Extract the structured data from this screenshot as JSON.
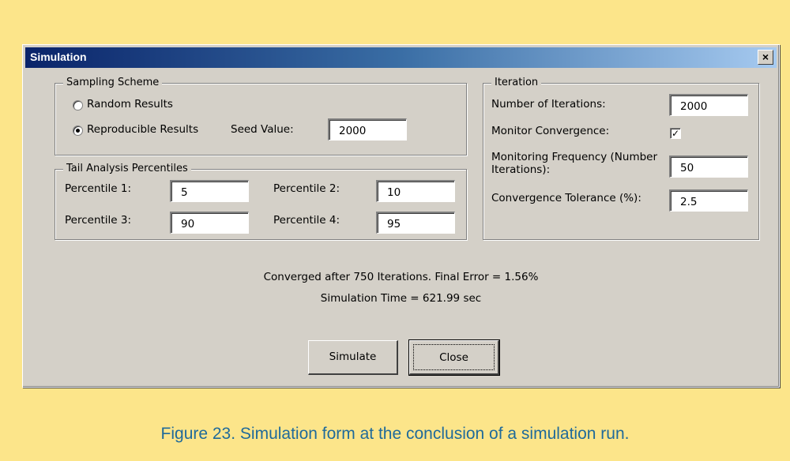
{
  "window": {
    "title": "Simulation",
    "close_glyph": "×"
  },
  "sampling": {
    "group_label": "Sampling Scheme",
    "random_label": "Random Results",
    "reproducible_label": "Reproducible Results",
    "selected": "Reproducible Results",
    "seed_label": "Seed Value:",
    "seed_value": "2000"
  },
  "tail": {
    "group_label": "Tail Analysis Percentiles",
    "p1_label": "Percentile 1:",
    "p1_value": "5",
    "p2_label": "Percentile 2:",
    "p2_value": "10",
    "p3_label": "Percentile 3:",
    "p3_value": "90",
    "p4_label": "Percentile 4:",
    "p4_value": "95"
  },
  "iteration": {
    "group_label": "Iteration",
    "num_label": "Number of Iterations:",
    "num_value": "2000",
    "monitor_label": "Monitor Convergence:",
    "monitor_checked": true,
    "check_glyph": "✓",
    "freq_label": "Monitoring Frequency (Number Iterations):",
    "freq_value": "50",
    "tol_label": "Convergence Tolerance (%):",
    "tol_value": "2.5"
  },
  "status": {
    "line1": "Converged after 750 Iterations.  Final Error = 1.56%",
    "line2": "Simulation Time = 621.99 sec"
  },
  "buttons": {
    "simulate": "Simulate",
    "close": "Close"
  },
  "caption": "Figure 23. Simulation form at the conclusion of a simulation run.",
  "colors": {
    "page_background": "#fce58a",
    "dialog_face": "#d4d0c8",
    "titlebar_start": "#0a246a",
    "caption_text": "#1f6a9a"
  }
}
